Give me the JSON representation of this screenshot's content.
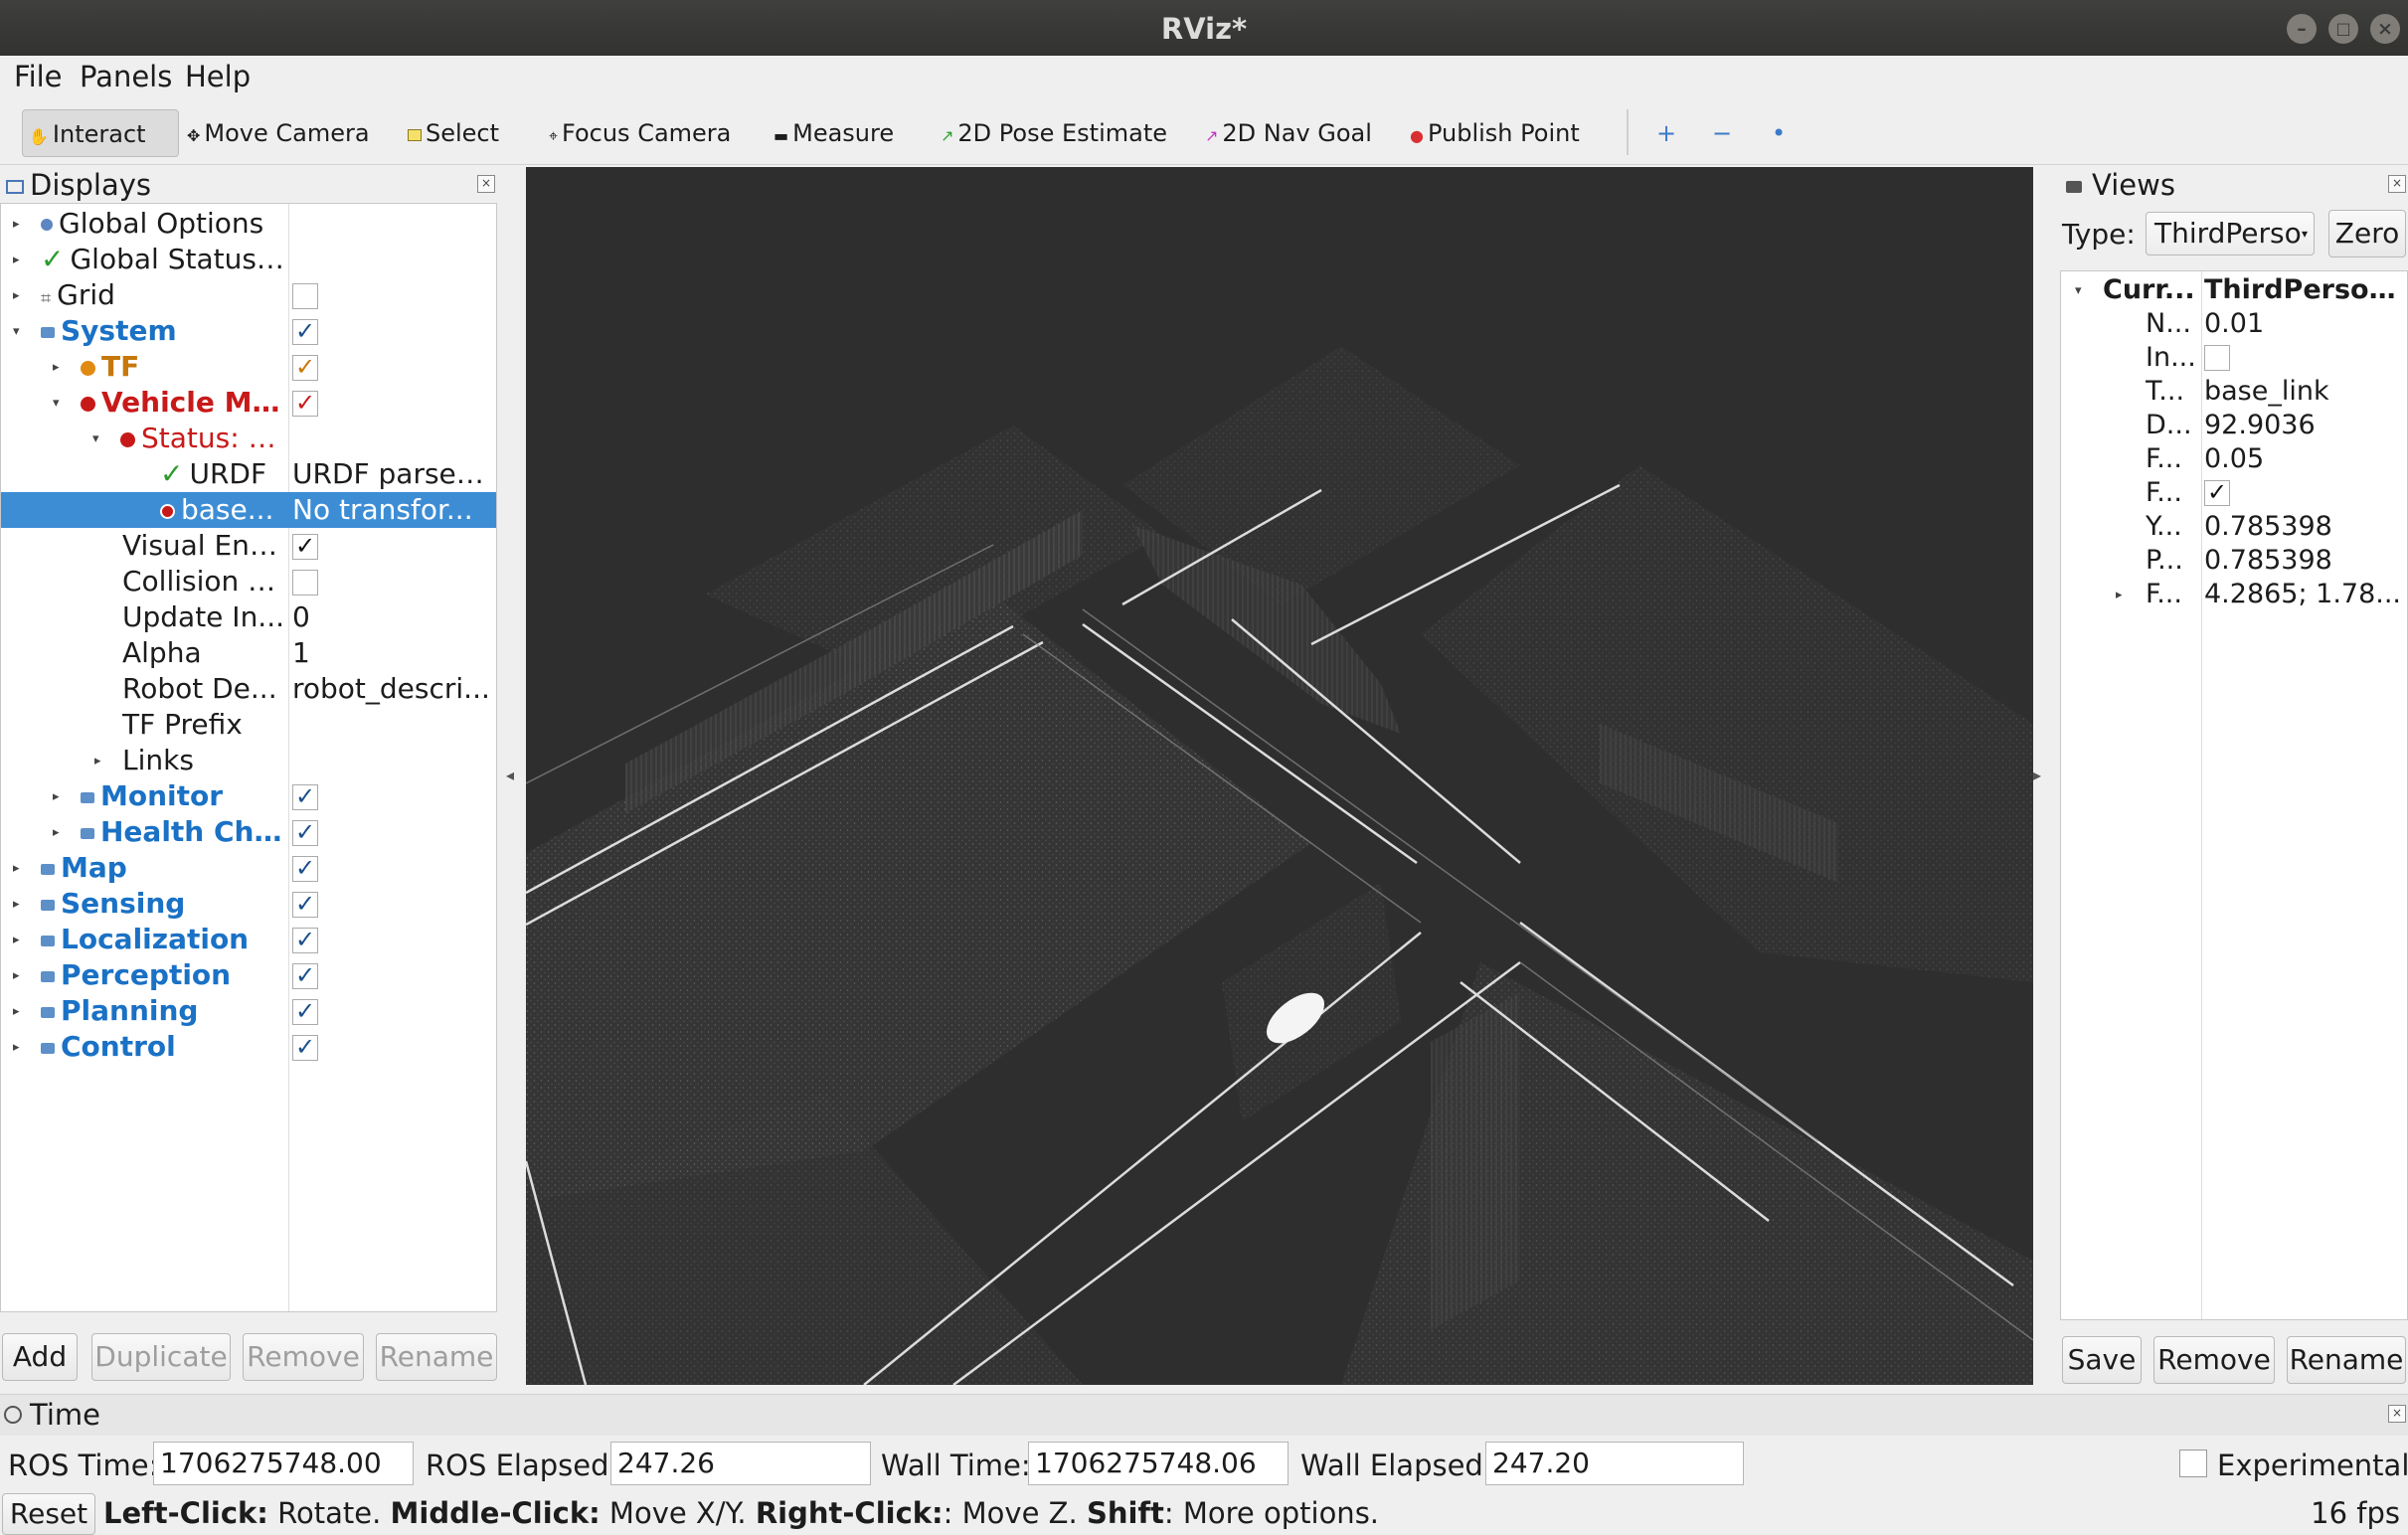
{
  "window": {
    "title": "RViz*",
    "min": "–",
    "max": "□",
    "close": "×"
  },
  "menu": [
    "File",
    "Panels",
    "Help"
  ],
  "toolbar": {
    "tools": [
      "Interact",
      "Move Camera",
      "Select",
      "Focus Camera",
      "Measure",
      "2D Pose Estimate",
      "2D Nav Goal",
      "Publish Point"
    ],
    "active": "Interact",
    "extra": [
      "+",
      "−",
      "•"
    ]
  },
  "displays": {
    "title": "Displays",
    "rows": [
      {
        "label": "Global Options"
      },
      {
        "label": "Global Status: ..."
      },
      {
        "label": "Grid",
        "checked": false
      },
      {
        "label": "System",
        "checked": true
      },
      {
        "label": "TF",
        "checked": true
      },
      {
        "label": "Vehicle Mo...",
        "checked": true
      },
      {
        "label": "Status: E..."
      },
      {
        "label": "URDF",
        "value": "URDF parsed..."
      },
      {
        "label": "base...",
        "value": "No transfor...",
        "selected": true
      },
      {
        "label": "Visual Ena...",
        "checked": true
      },
      {
        "label": "Collision E...",
        "checked": false
      },
      {
        "label": "Update In...",
        "value": "0"
      },
      {
        "label": "Alpha",
        "value": "1"
      },
      {
        "label": "Robot De...",
        "value": "robot_descri..."
      },
      {
        "label": "TF Prefix"
      },
      {
        "label": "Links"
      },
      {
        "label": "Monitor",
        "checked": true
      },
      {
        "label": "Health Che...",
        "checked": true
      },
      {
        "label": "Map",
        "checked": true
      },
      {
        "label": "Sensing",
        "checked": true
      },
      {
        "label": "Localization",
        "checked": true
      },
      {
        "label": "Perception",
        "checked": true
      },
      {
        "label": "Planning",
        "checked": true
      },
      {
        "label": "Control",
        "checked": true
      }
    ],
    "buttons": [
      "Add",
      "Duplicate",
      "Remove",
      "Rename"
    ]
  },
  "views": {
    "title": "Views",
    "type_label": "Type:",
    "type_value": "ThirdPerso",
    "zero": "Zero",
    "header": {
      "label": "Curr...",
      "value": "ThirdPerson..."
    },
    "props": [
      {
        "label": "N...",
        "value": "0.01"
      },
      {
        "label": "In...",
        "checked": false
      },
      {
        "label": "T...",
        "value": "base_link"
      },
      {
        "label": "D...",
        "value": "92.9036"
      },
      {
        "label": "F...",
        "value": "0.05"
      },
      {
        "label": "F...",
        "checked": true
      },
      {
        "label": "Y...",
        "value": "0.785398"
      },
      {
        "label": "P...",
        "value": "0.785398"
      },
      {
        "label": "F...",
        "value": "4.2865; 1.78..."
      }
    ],
    "buttons": [
      "Save",
      "Remove",
      "Rename"
    ]
  },
  "time": {
    "title": "Time",
    "ros_time_label": "ROS Time:",
    "ros_time": "1706275748.00",
    "ros_elapsed_label": "ROS Elapsed:",
    "ros_elapsed": "247.26",
    "wall_time_label": "Wall Time:",
    "wall_time": "1706275748.06",
    "wall_elapsed_label": "Wall Elapsed:",
    "wall_elapsed": "247.20",
    "experimental": "Experimental"
  },
  "status": {
    "reset": "Reset",
    "k1": "Left-Click:",
    "v1": " Rotate. ",
    "k2": "Middle-Click:",
    "v2": " Move X/Y. ",
    "k3": "Right-Click:",
    "v3": ": Move Z. ",
    "k4": "Shift",
    "v4": ": More options.",
    "fps": "16 fps"
  },
  "colors": {
    "accent": "#3d8dd5",
    "viewport": "#2e2e2e",
    "error": "#c81919",
    "warn": "#c6780b",
    "ok": "#2a9a2a",
    "category": "#1a71c5"
  }
}
